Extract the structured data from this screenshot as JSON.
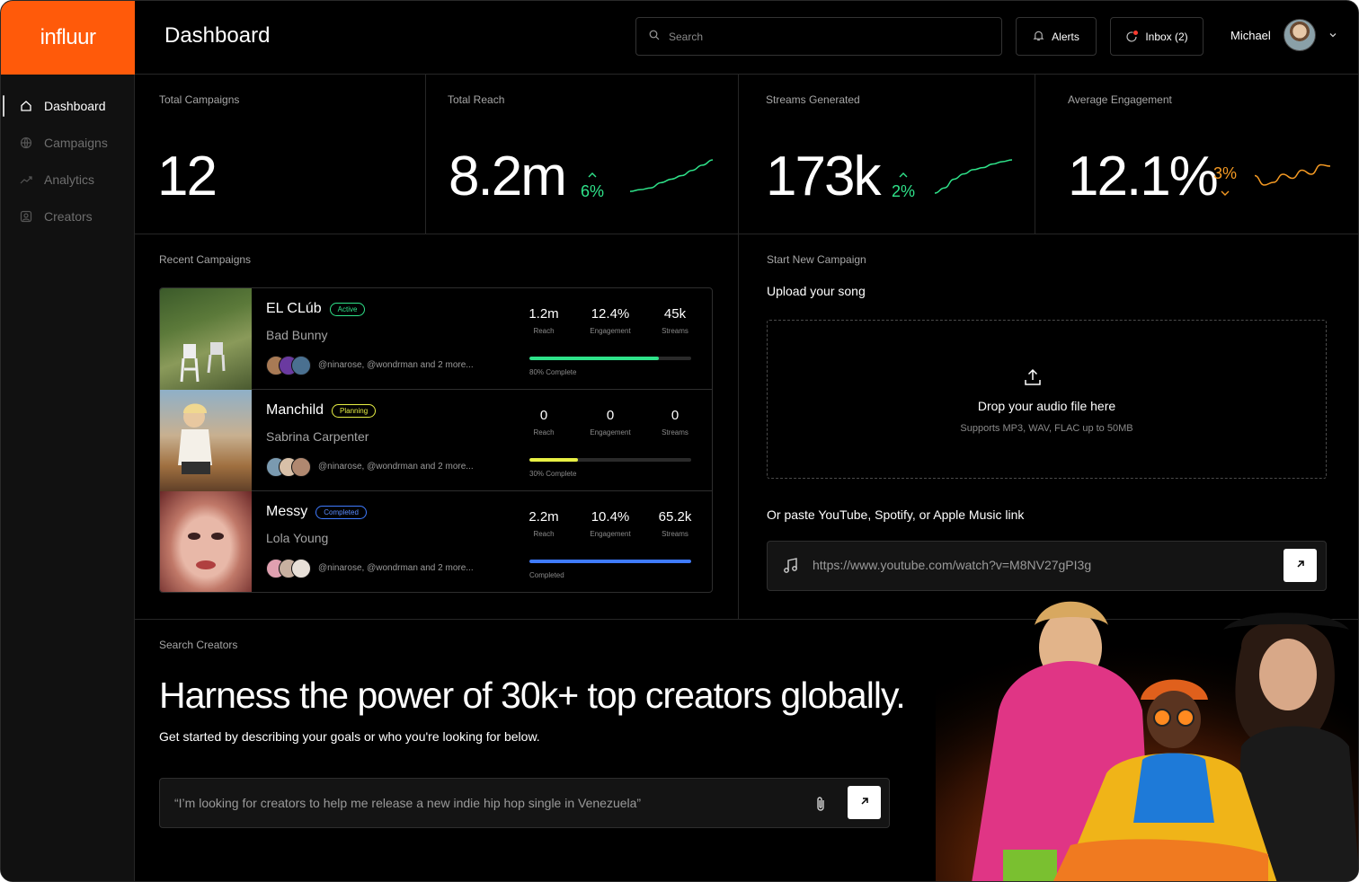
{
  "brand": {
    "name": "influur",
    "color": "#ff5a0a"
  },
  "sidebar": {
    "items": [
      {
        "label": "Dashboard",
        "icon": "home-icon",
        "active": true
      },
      {
        "label": "Campaigns",
        "icon": "globe-icon",
        "active": false
      },
      {
        "label": "Analytics",
        "icon": "trend-icon",
        "active": false
      },
      {
        "label": "Creators",
        "icon": "user-card-icon",
        "active": false
      }
    ]
  },
  "header": {
    "title": "Dashboard",
    "search_placeholder": "Search",
    "alerts_label": "Alerts",
    "inbox_label": "Inbox (2)",
    "user_name": "Michael"
  },
  "stats": [
    {
      "label": "Total Campaigns",
      "value": "12"
    },
    {
      "label": "Total Reach",
      "value": "8.2m",
      "delta": "6%",
      "direction": "up",
      "trend": [
        0.1,
        0.15,
        0.2,
        0.35,
        0.45,
        0.55,
        0.7,
        0.85,
        1.0
      ]
    },
    {
      "label": "Streams Generated",
      "value": "173k",
      "delta": "2%",
      "direction": "up",
      "trend": [
        0.05,
        0.2,
        0.45,
        0.6,
        0.72,
        0.78,
        0.88,
        0.95,
        1.0
      ]
    },
    {
      "label": "Average Engagement",
      "value": "12.1%",
      "delta": "3%",
      "direction": "down",
      "trend": [
        0.55,
        0.2,
        0.3,
        0.6,
        0.45,
        0.75,
        0.6,
        0.95,
        0.9
      ]
    }
  ],
  "recent_campaigns": {
    "label": "Recent Campaigns",
    "rows": [
      {
        "title": "EL CLúb",
        "status": "Active",
        "status_color": "#2fe38a",
        "artist": "Bad Bunny",
        "handles": "@ninarose, @wondrman and 2 more...",
        "reach": "1.2m",
        "engagement": "12.4%",
        "streams": "45k",
        "progress": 0.8,
        "progress_label": "80% Complete",
        "bar_color": "#2fe38a"
      },
      {
        "title": "Manchild",
        "status": "Planning",
        "status_color": "#e8f044",
        "artist": "Sabrina Carpenter",
        "handles": "@ninarose, @wondrman and 2 more...",
        "reach": "0",
        "engagement": "0",
        "streams": "0",
        "progress": 0.3,
        "progress_label": "30% Complete",
        "bar_color": "#e8f044"
      },
      {
        "title": "Messy",
        "status": "Completed",
        "status_color": "#3f7bff",
        "artist": "Lola Young",
        "handles": "@ninarose, @wondrman and 2 more...",
        "reach": "2.2m",
        "engagement": "10.4%",
        "streams": "65.2k",
        "progress": 1.0,
        "progress_label": "Completed",
        "bar_color": "#3f7bff"
      }
    ],
    "metric_labels": {
      "reach": "Reach",
      "engagement": "Engagement",
      "streams": "Streams"
    }
  },
  "start_campaign": {
    "label": "Start New Campaign",
    "heading": "Upload your song",
    "drop_title": "Drop your audio file here",
    "drop_subtitle": "Supports MP3, WAV, FLAC up to 50MB",
    "link_heading": "Or paste YouTube, Spotify, or Apple Music link",
    "link_value": "https://www.youtube.com/watch?v=M8NV27gPI3g"
  },
  "search_creators": {
    "label": "Search Creators",
    "headline": "Harness the power of 30k+ top creators globally.",
    "subtitle": "Get started by describing your goals or who you're looking for below.",
    "prompt_value": "“I’m looking for creators to help me release a new indie hip hop single in Venezuela”"
  }
}
